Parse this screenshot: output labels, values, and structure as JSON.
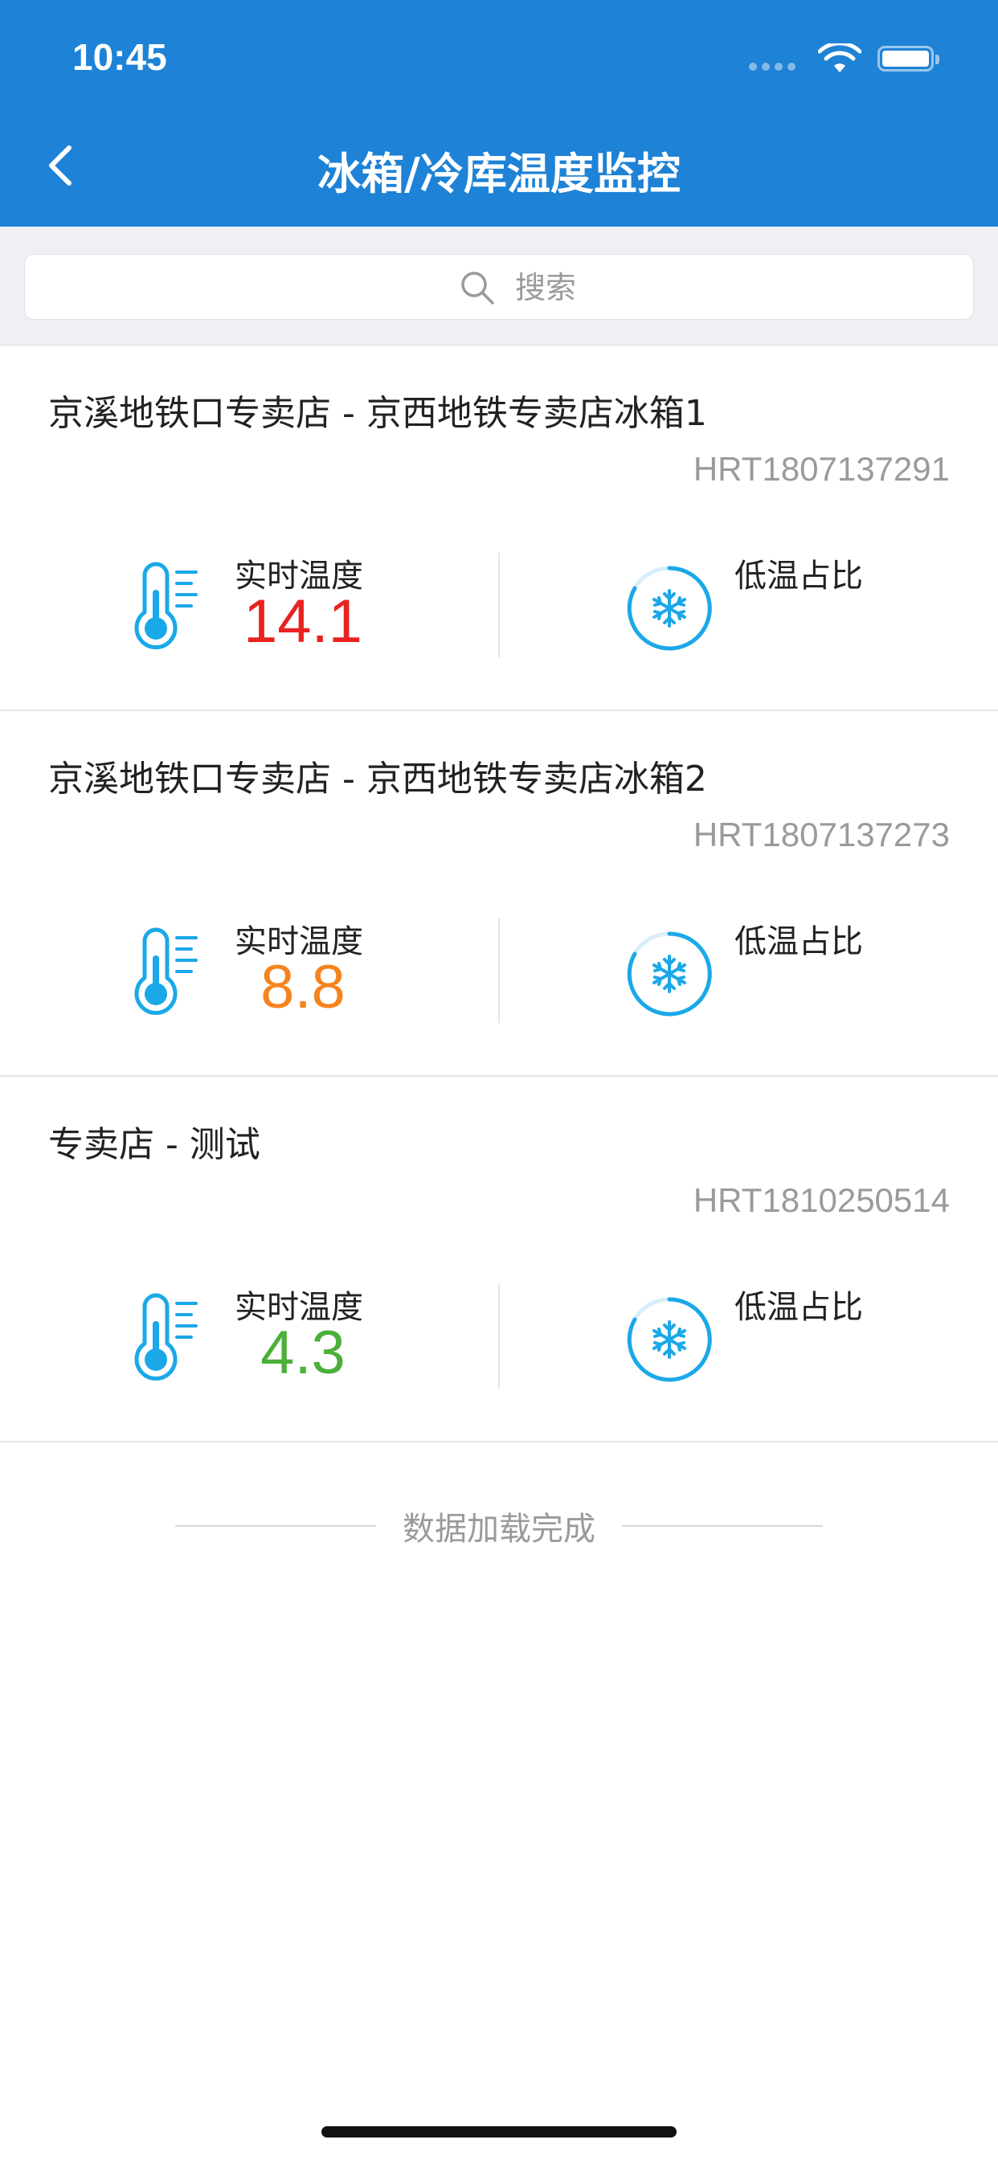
{
  "status_bar": {
    "time": "10:45"
  },
  "nav": {
    "title": "冰箱/冷库温度监控",
    "back_icon": "chevron-left-icon"
  },
  "search": {
    "placeholder": "搜索",
    "value": "",
    "icon": "search-icon"
  },
  "temp_label": "实时温度",
  "ratio_label": "低温占比",
  "colors": {
    "header": "#1e82d6",
    "icon": "#1aa8e8",
    "temp_high": "#e8231f",
    "temp_mid": "#f5841f",
    "temp_low": "#4caf3a"
  },
  "devices": [
    {
      "name": "京溪地铁口专卖店 - 京西地铁专卖店冰箱1",
      "code": "HRT1807137291",
      "temperature": "14.1",
      "temp_color": "#e8231f"
    },
    {
      "name": "京溪地铁口专卖店 - 京西地铁专卖店冰箱2",
      "code": "HRT1807137273",
      "temperature": "8.8",
      "temp_color": "#f5841f"
    },
    {
      "name": "专卖店 - 测试",
      "code": "HRT1810250514",
      "temperature": "4.3",
      "temp_color": "#4caf3a"
    }
  ],
  "footer": {
    "text": "数据加载完成"
  }
}
